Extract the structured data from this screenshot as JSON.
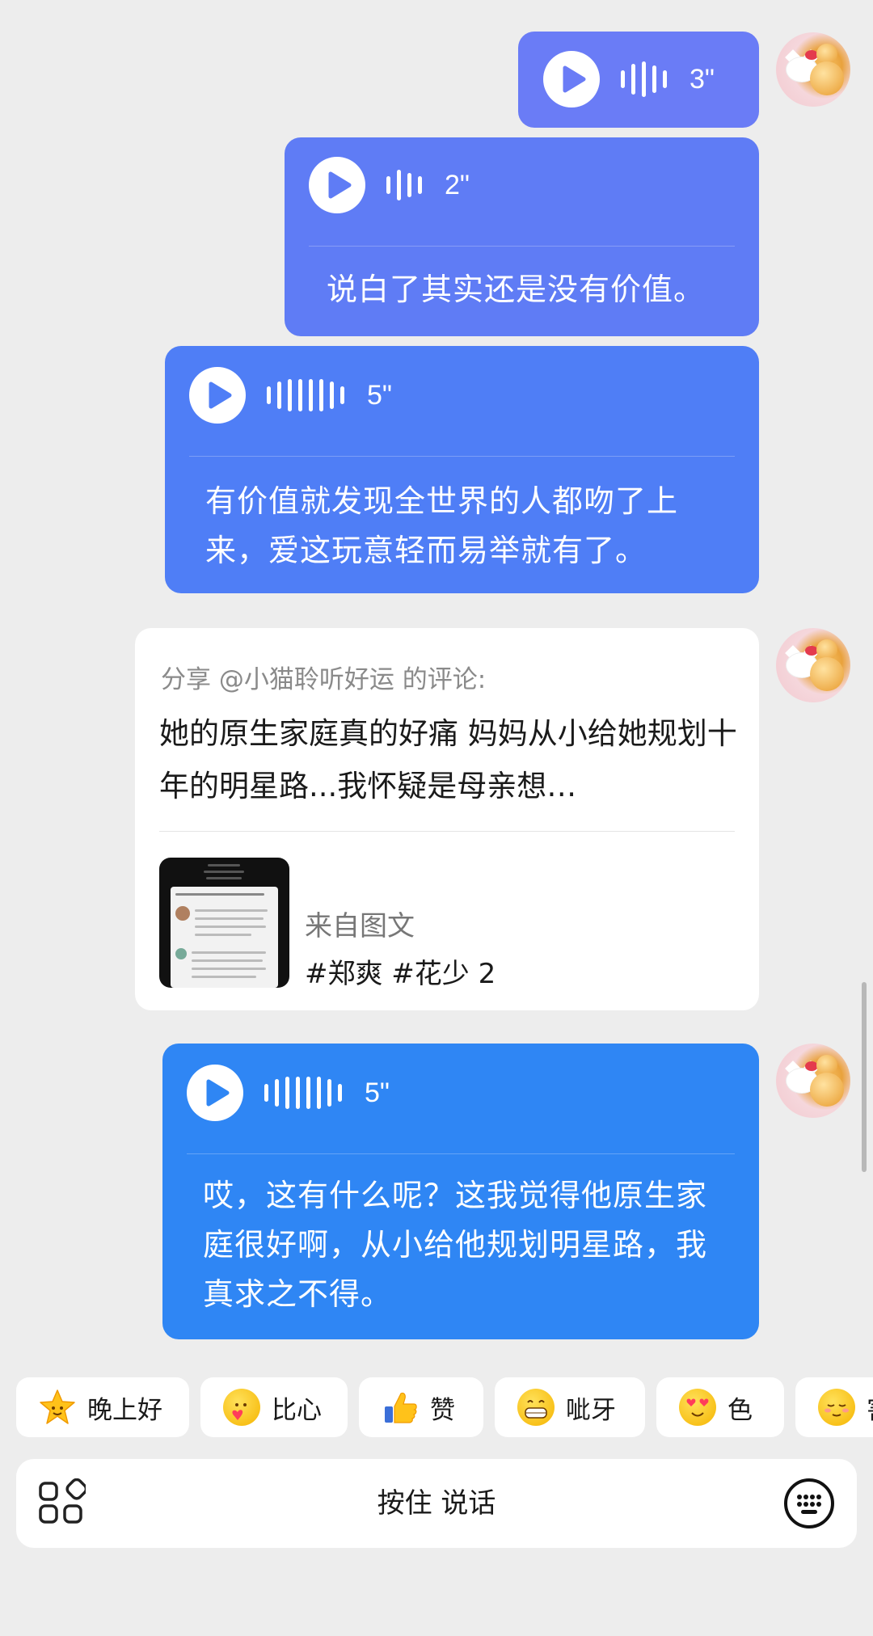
{
  "messages": [
    {
      "type": "voice",
      "duration": "3\"",
      "transcript": ""
    },
    {
      "type": "voice",
      "duration": "2\"",
      "transcript": "说白了其实还是没有价值。"
    },
    {
      "type": "voice",
      "duration": "5\"",
      "transcript": "有价值就发现全世界的人都吻了上来，爱这玩意轻而易举就有了。"
    },
    {
      "type": "share",
      "header": "分享 @小猫聆听好运 的评论:",
      "comment": "她的原生家庭真的好痛 妈妈从小给她规划十年的明星路...我怀疑是母亲想…",
      "source": "来自图文",
      "tags": "#郑爽 #花少 2"
    },
    {
      "type": "voice",
      "duration": "5\"",
      "transcript": "哎，这有什么呢？这我觉得他原生家庭很好啊，从小给他规划明星路，我真求之不得。"
    }
  ],
  "quick_replies": [
    {
      "icon": "star-face-emoji-icon",
      "label": "晚上好"
    },
    {
      "icon": "heart-hands-emoji-icon",
      "label": "比心"
    },
    {
      "icon": "thumbs-up-emoji-icon",
      "label": "赞"
    },
    {
      "icon": "grin-emoji-icon",
      "label": "呲牙"
    },
    {
      "icon": "heart-eyes-emoji-icon",
      "label": "色"
    },
    {
      "icon": "shy-emoji-icon",
      "label": "害"
    }
  ],
  "input": {
    "hold_to_talk": "按住 说话"
  },
  "colors": {
    "background": "#ededed",
    "voice_bubble_1": "#6a7cf6",
    "voice_bubble_2": "#5f7cf5",
    "voice_bubble_3": "#4f7ef6",
    "voice_bubble_4": "#2f86f4"
  }
}
